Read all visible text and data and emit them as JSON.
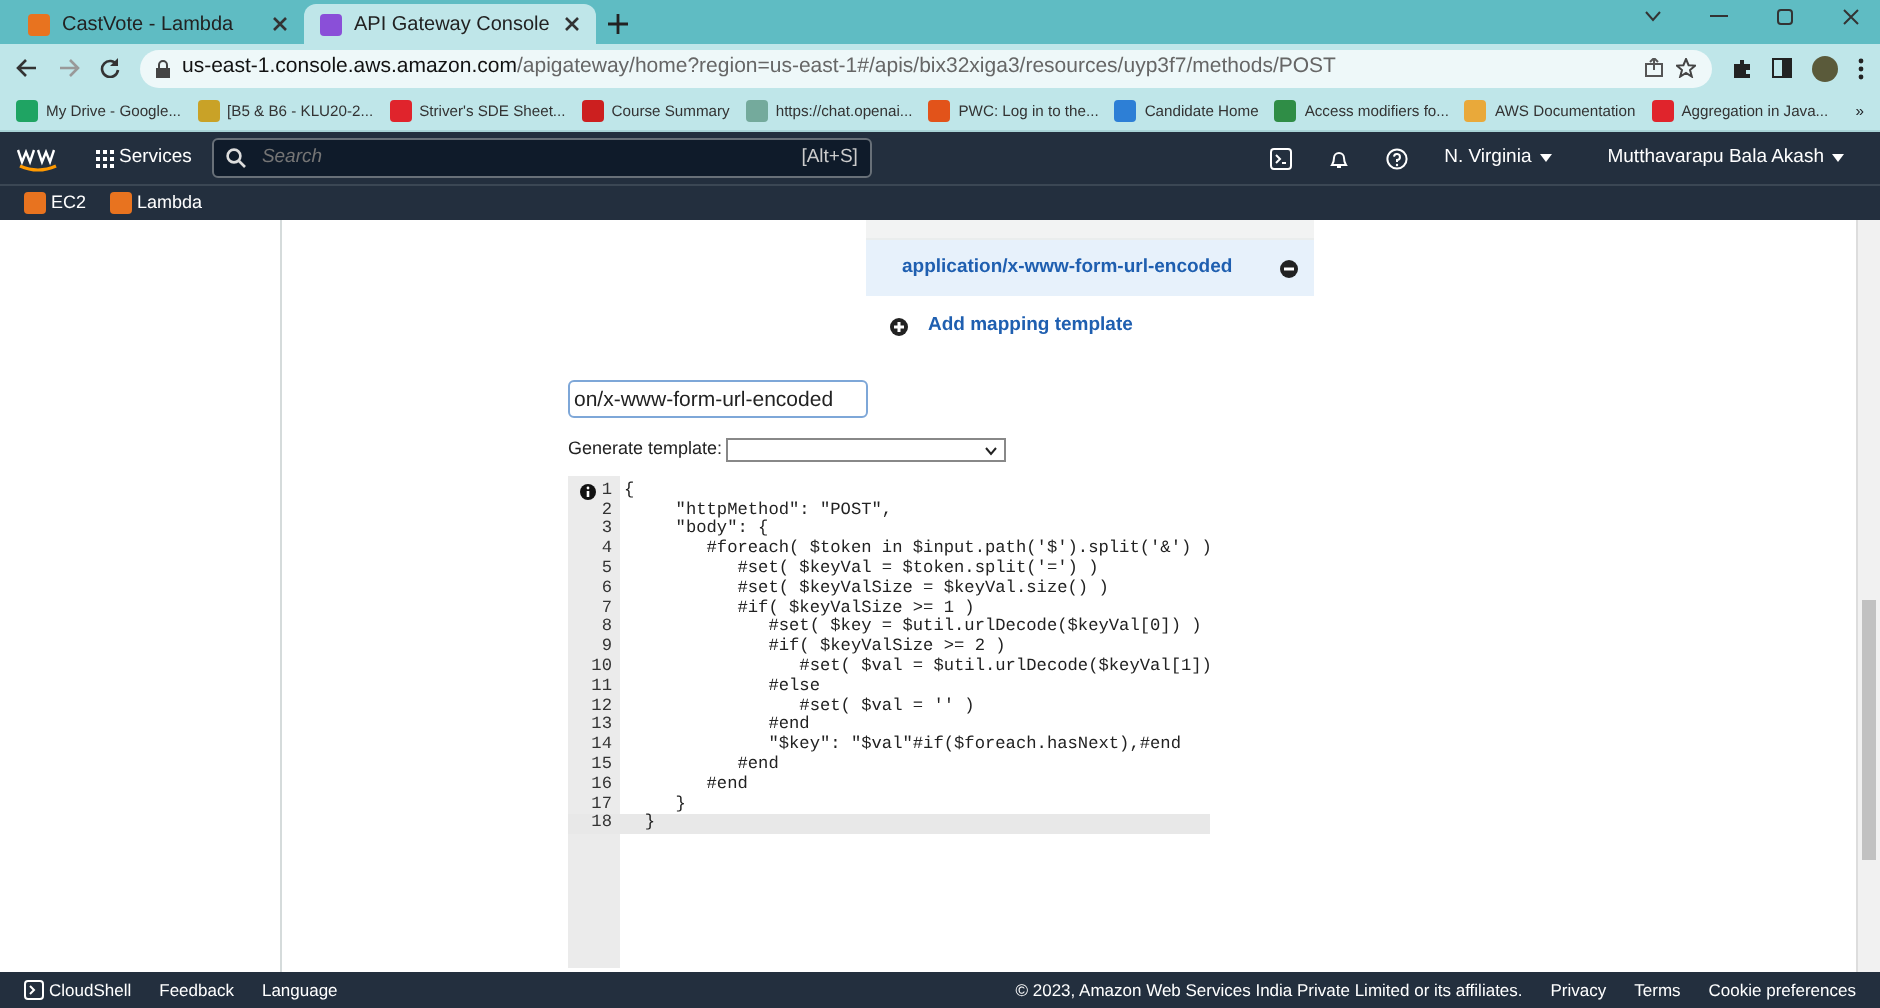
{
  "browser": {
    "tabs": [
      {
        "title": "CastVote - Lambda",
        "color": "#e8731f",
        "selected": false
      },
      {
        "title": "API Gateway Console",
        "color": "#8a4fd8",
        "selected": true
      }
    ],
    "url": {
      "host": "us-east-1.console.aws.amazon.com",
      "path": "/apigateway/home?region=us-east-1#/apis/bix32xiga3/resources/uyp3f7/methods/POST"
    },
    "bookmarks": [
      {
        "label": "My Drive - Google...",
        "color": "#1fa463"
      },
      {
        "label": "[B5 & B6 - KLU20-2...",
        "color": "#c9a227"
      },
      {
        "label": "Striver's SDE Sheet...",
        "color": "#e0242c"
      },
      {
        "label": "Course Summary",
        "color": "#cc1f1f"
      },
      {
        "label": "https://chat.openai...",
        "color": "#74aa9c"
      },
      {
        "label": "PWC: Log in to the...",
        "color": "#e2531a"
      },
      {
        "label": "Candidate Home",
        "color": "#2d7fd6"
      },
      {
        "label": "Access modifiers fo...",
        "color": "#2f8d46"
      },
      {
        "label": "AWS Documentation",
        "color": "#e9a93a"
      },
      {
        "label": "Aggregation in Java...",
        "color": "#e0242c"
      }
    ],
    "more_bookmarks": "»"
  },
  "aws_nav": {
    "services": "Services",
    "search_placeholder": "Search",
    "search_shortcut": "[Alt+S]",
    "region": "N. Virginia",
    "user": "Mutthavarapu Bala Akash",
    "favorites": [
      {
        "label": "EC2",
        "color": "#e8731f"
      },
      {
        "label": "Lambda",
        "color": "#e8731f"
      }
    ]
  },
  "mapping_templates": {
    "rows": [
      {
        "content_type": "application/x-www-form-url-encoded",
        "selected": true
      }
    ],
    "add_link": "Add mapping template"
  },
  "content_type_field": {
    "value": "on/x-www-form-url-encoded"
  },
  "generate_template": {
    "label": "Generate template:"
  },
  "editor": {
    "lines": [
      {
        "number": "1",
        "text": "{",
        "info": true,
        "active": false
      },
      {
        "number": "2",
        "text": "     \"httpMethod\": \"POST\",",
        "info": false,
        "active": false
      },
      {
        "number": "3",
        "text": "     \"body\": {",
        "info": false,
        "active": false
      },
      {
        "number": "4",
        "text": "        #foreach( $token in $input.path('$').split('&') )",
        "info": false,
        "active": false
      },
      {
        "number": "5",
        "text": "           #set( $keyVal = $token.split('=') )",
        "info": false,
        "active": false
      },
      {
        "number": "6",
        "text": "           #set( $keyValSize = $keyVal.size() )",
        "info": false,
        "active": false
      },
      {
        "number": "7",
        "text": "           #if( $keyValSize >= 1 )",
        "info": false,
        "active": false
      },
      {
        "number": "8",
        "text": "              #set( $key = $util.urlDecode($keyVal[0]) )",
        "info": false,
        "active": false
      },
      {
        "number": "9",
        "text": "              #if( $keyValSize >= 2 )",
        "info": false,
        "active": false
      },
      {
        "number": "10",
        "text": "                 #set( $val = $util.urlDecode($keyVal[1])",
        "info": false,
        "active": false
      },
      {
        "number": "11",
        "text": "              #else",
        "info": false,
        "active": false
      },
      {
        "number": "12",
        "text": "                 #set( $val = '' )",
        "info": false,
        "active": false
      },
      {
        "number": "13",
        "text": "              #end",
        "info": false,
        "active": false
      },
      {
        "number": "14",
        "text": "              \"$key\": \"$val\"#if($foreach.hasNext),#end",
        "info": false,
        "active": false
      },
      {
        "number": "15",
        "text": "           #end",
        "info": false,
        "active": false
      },
      {
        "number": "16",
        "text": "        #end",
        "info": false,
        "active": false
      },
      {
        "number": "17",
        "text": "     }",
        "info": false,
        "active": false
      },
      {
        "number": "18",
        "text": "  }",
        "info": false,
        "active": true
      }
    ]
  },
  "footer": {
    "left": [
      "CloudShell",
      "Feedback",
      "Language"
    ],
    "copyright": "© 2023, Amazon Web Services India Private Limited or its affiliates.",
    "right": [
      "Privacy",
      "Terms",
      "Cookie preferences"
    ]
  }
}
